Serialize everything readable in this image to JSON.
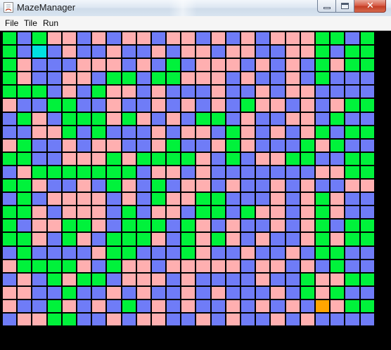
{
  "window": {
    "title": "MazeManager"
  },
  "menu": {
    "items": [
      "File",
      "Tile",
      "Run"
    ]
  },
  "maze": {
    "rows": 22,
    "cols": 25,
    "colors": {
      "G": "#00f23b",
      "B": "#6f7cf7",
      "P": "#ffafb0",
      "C": "#00e1e1",
      "O": "#ffa500"
    },
    "grid": [
      "GBGPPBPBPPBPPBPBPBPPPGGBG",
      "GBCBPBBPBBPBPPBPPBBPPGBG",
      "GPBBBPPPBPBGBPPPBPBPBGPG",
      "GPBBPPBGGBGGPPPBPBBPBGBB",
      "GGGBPBGPPBPBBBPBBPBPPBBB",
      "PBBGGBBPBBPBPBPBGPPBPBPG",
      "BGPBGGGPGPBPBGGBPBBPPBGB",
      "BBPPGBGBBBPBPPBGPBPBPGBG",
      "PGBBPBPPBBPGBBPGPBBBGPGB",
      "GGBBPPPGPGGGGPBGBPPGGBBG",
      "BPGGGGGGGBPPBPBBBBBBBPPG",
      "GGPBBPBGPBGBPPBPBBPBPBBP",
      "BGBPPPPBPBGPPGGBBBPBPGPB",
      "GGPBPPPBGBPPBGGBGPPBPGPB",
      "GBPPGGPBGGGBGPBPBBPBPGBG",
      "GGPBGPBGGGPBGPGPBPBBPGPG",
      "BGBBBBPGGBBBGPBBPBBPBGGB",
      "PGGGGPBGPPBPPPPPBPPBPBGB",
      "BPBGPGGBPPPBPBBBBPBBGPPG",
      "PPBBGBBPBPBBPBPBBBPBGPGB",
      "PBBGPBPBGBPBPBBPBPBPBOPG",
      "BPPGGBBPBPPBBPBPBBPBPBBB"
    ]
  }
}
